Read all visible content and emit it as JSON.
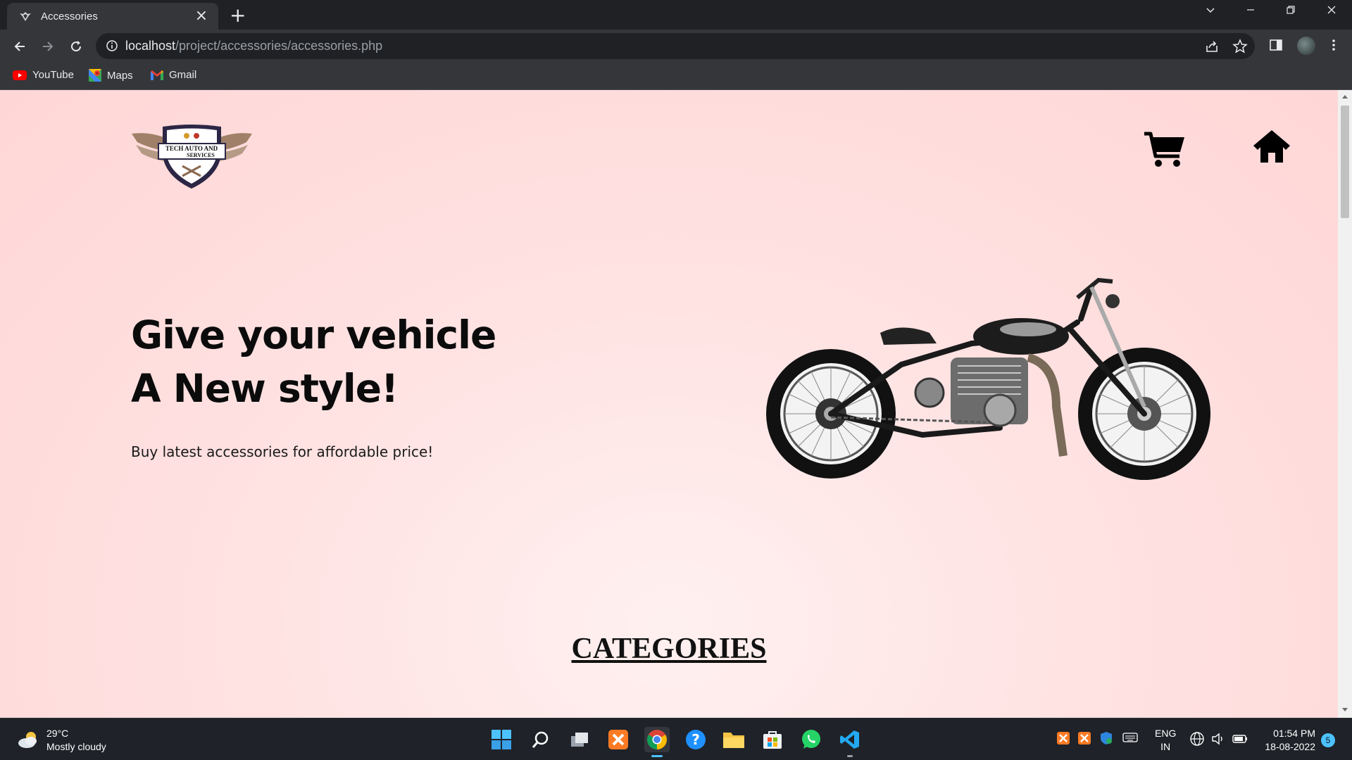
{
  "browser": {
    "tab_title": "Accessories",
    "url_host": "localhost",
    "url_path": "/project/accessories/accessories.php",
    "bookmarks": [
      {
        "label": "YouTube",
        "icon": "youtube-icon"
      },
      {
        "label": "Maps",
        "icon": "maps-icon"
      },
      {
        "label": "Gmail",
        "icon": "gmail-icon"
      }
    ]
  },
  "page": {
    "logo_text_line1": "TECH AUTO AND",
    "logo_text_line2": "SERVICES",
    "hero_line1": "Give your vehicle",
    "hero_line2": "A New style!",
    "hero_subtitle": "Buy latest accessories for affordable price!",
    "section_title": "CATEGORIES",
    "nav_icons": [
      "cart-icon",
      "home-icon"
    ]
  },
  "taskbar": {
    "weather_temp": "29°C",
    "weather_desc": "Mostly cloudy",
    "lang_line1": "ENG",
    "lang_line2": "IN",
    "time": "01:54 PM",
    "date": "18-08-2022",
    "notification_count": "5"
  },
  "colors": {
    "page_bg": "#ffdcdc",
    "chrome_dark": "#202124",
    "chrome_mid": "#35363a",
    "taskbar": "#1f2228"
  }
}
